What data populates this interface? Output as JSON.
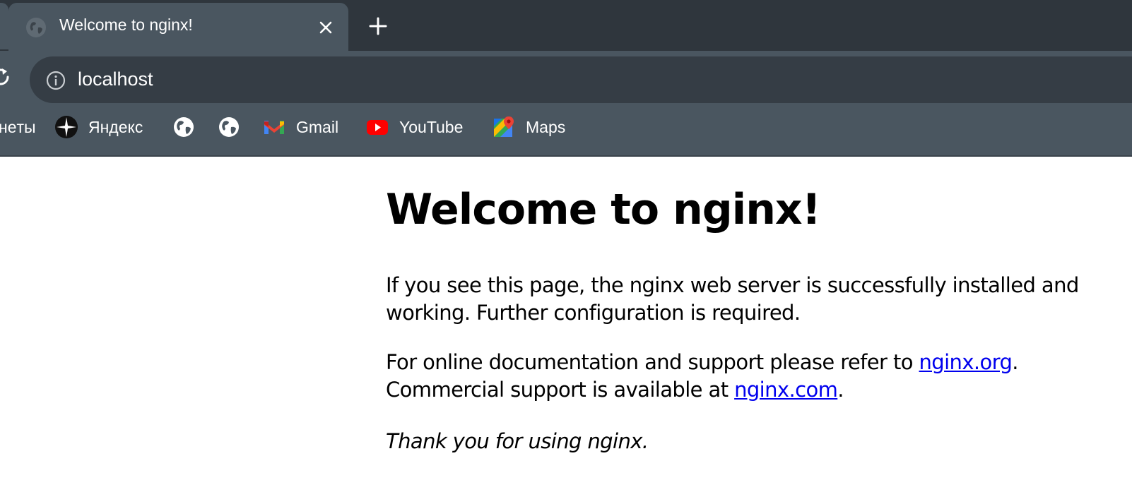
{
  "browser": {
    "tab": {
      "title": "Welcome to nginx!",
      "favicon": "globe-icon",
      "close_icon": "close-icon"
    },
    "new_tab_icon": "plus-icon",
    "address_bar": {
      "url": "localhost",
      "site_info_icon": "info-icon"
    },
    "bookmarks": [
      {
        "label": "нeты",
        "icon": null
      },
      {
        "label": "Яндекс",
        "icon": "yandex-icon"
      },
      {
        "label": "",
        "icon": "globe-icon"
      },
      {
        "label": "",
        "icon": "globe-icon"
      },
      {
        "label": "Gmail",
        "icon": "gmail-icon"
      },
      {
        "label": "YouTube",
        "icon": "youtube-icon"
      },
      {
        "label": "Maps",
        "icon": "maps-icon"
      }
    ],
    "colors": {
      "tabstrip": "#2f363d",
      "toolbar": "#4a5660",
      "omnibox": "#353d45"
    }
  },
  "page": {
    "heading": "Welcome to nginx!",
    "paragraph1": {
      "line1": "If you see this page, the nginx web server is successfully installed and",
      "line2": "working. Further configuration is required."
    },
    "paragraph2": {
      "line1_prefix": "For online documentation and support please refer to ",
      "link1": "nginx.org",
      "line1_suffix": ".",
      "line2_prefix": "Commercial support is available at ",
      "link2": "nginx.com",
      "line2_suffix": "."
    },
    "thanks": "Thank you for using nginx.",
    "link_color": "#0000ee"
  }
}
